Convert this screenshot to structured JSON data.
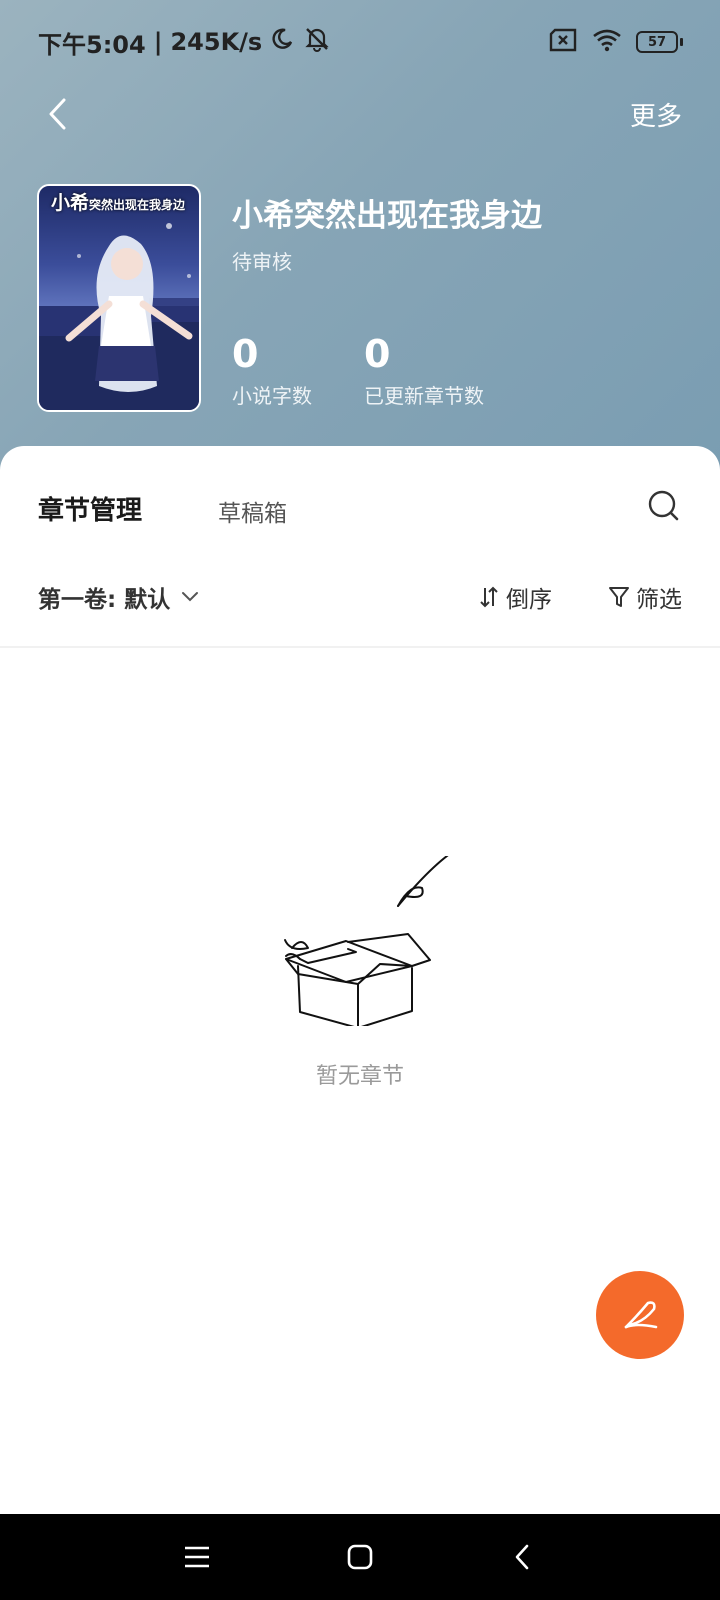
{
  "status_bar": {
    "time": "下午5:04",
    "network_speed": "245K/s",
    "battery_level": "57",
    "icons": [
      "moon-icon",
      "mute-icon",
      "sim-card-icon",
      "wifi-icon",
      "battery-icon"
    ]
  },
  "nav": {
    "more_label": "更多",
    "back_icon": "chevron-left-icon"
  },
  "book": {
    "cover_title_char": "小希",
    "cover_title_rest": "突然出现在我身边",
    "title": "小希突然出现在我身边",
    "status": "待审核",
    "stats": [
      {
        "value": "0",
        "label": "小说字数"
      },
      {
        "value": "0",
        "label": "已更新章节数"
      }
    ]
  },
  "tabs": {
    "active": "章节管理",
    "inactive": "草稿箱"
  },
  "toolbar": {
    "volume_label": "第一卷: 默认",
    "sort_label": "倒序",
    "filter_label": "筛选"
  },
  "empty_state": {
    "text": "暂无章节"
  },
  "colors": {
    "accent": "#f46a2b",
    "header_bg": "#87a5b6"
  }
}
